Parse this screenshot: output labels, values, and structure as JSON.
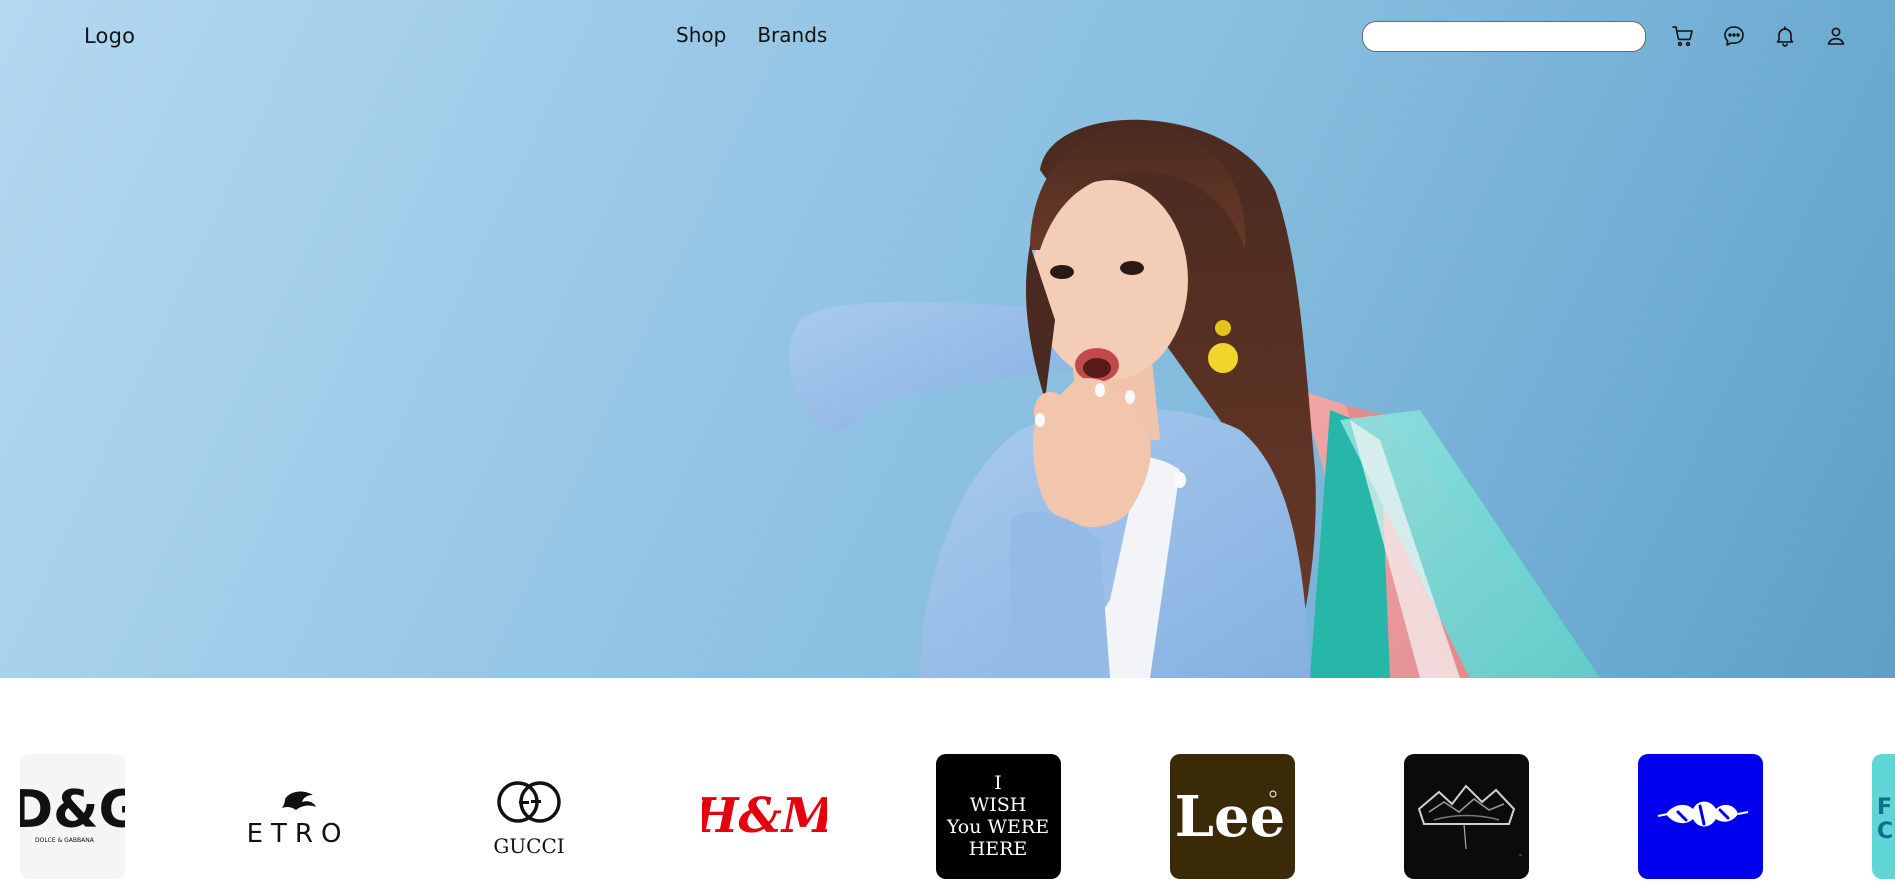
{
  "header": {
    "logo_text": "Logo",
    "nav": [
      {
        "label": "Shop"
      },
      {
        "label": "Brands"
      }
    ],
    "search": {
      "placeholder": "",
      "value": ""
    },
    "icons": [
      "cart-icon",
      "chat-icon",
      "bell-icon",
      "user-icon"
    ]
  },
  "hero": {
    "background_colors": [
      "#b4d8f0",
      "#86bddf",
      "#5e9fc8"
    ],
    "image_subject": "woman with shopping bags"
  },
  "brands": [
    {
      "name": "D&G",
      "sub": "DOLCE & GABBANA",
      "bg": "#f5f5f5",
      "fg": "#111111"
    },
    {
      "name": "ETRO",
      "bg": "#ffffff",
      "fg": "#111111"
    },
    {
      "name": "GUCCI",
      "bg": "#ffffff",
      "fg": "#111111"
    },
    {
      "name": "H&M",
      "bg": "#ffffff",
      "fg": "#e50010"
    },
    {
      "lines": [
        "I",
        "WISH",
        "You WERE",
        "HERE"
      ],
      "bg": "#000000",
      "fg": "#ffffff"
    },
    {
      "name": "Lee",
      "bg": "#3a2a08",
      "fg": "#ffffff"
    },
    {
      "name": "",
      "bg": "#0b0b0b",
      "fg": "#cccccc"
    },
    {
      "name": "",
      "bg": "#0000ee",
      "fg": "#ffffff"
    },
    {
      "name": "F C",
      "bg": "#5fd6d6",
      "fg": "#0f6f8f"
    }
  ]
}
